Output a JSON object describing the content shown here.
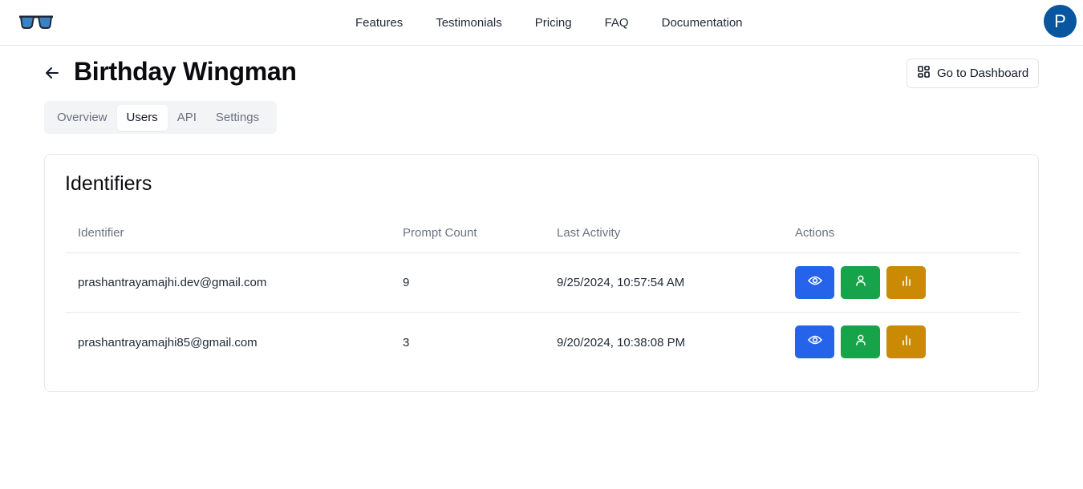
{
  "nav": {
    "logo_icon": "sunglasses-icon",
    "links": [
      "Features",
      "Testimonials",
      "Pricing",
      "FAQ",
      "Documentation"
    ],
    "avatar_initial": "P",
    "avatar_color": "#08569f"
  },
  "header": {
    "back_icon": "arrow-left-icon",
    "title": "Birthday Wingman",
    "dashboard_button": "Go to Dashboard",
    "dashboard_icon": "dashboard-grid-icon"
  },
  "tabs": [
    {
      "label": "Overview",
      "active": false
    },
    {
      "label": "Users",
      "active": true
    },
    {
      "label": "API",
      "active": false
    },
    {
      "label": "Settings",
      "active": false
    }
  ],
  "identifiers": {
    "title": "Identifiers",
    "columns": [
      "Identifier",
      "Prompt Count",
      "Last Activity",
      "Actions"
    ],
    "rows": [
      {
        "identifier": "prashantrayamajhi.dev@gmail.com",
        "prompt_count": "9",
        "last_activity": "9/25/2024, 10:57:54 AM"
      },
      {
        "identifier": "prashantrayamajhi85@gmail.com",
        "prompt_count": "3",
        "last_activity": "9/20/2024, 10:38:08 PM"
      }
    ],
    "action_icons": [
      "eye-icon",
      "user-icon",
      "bar-chart-icon"
    ],
    "action_colors": {
      "view": "#2563eb",
      "user": "#16a34a",
      "stats": "#ca8a04"
    }
  }
}
